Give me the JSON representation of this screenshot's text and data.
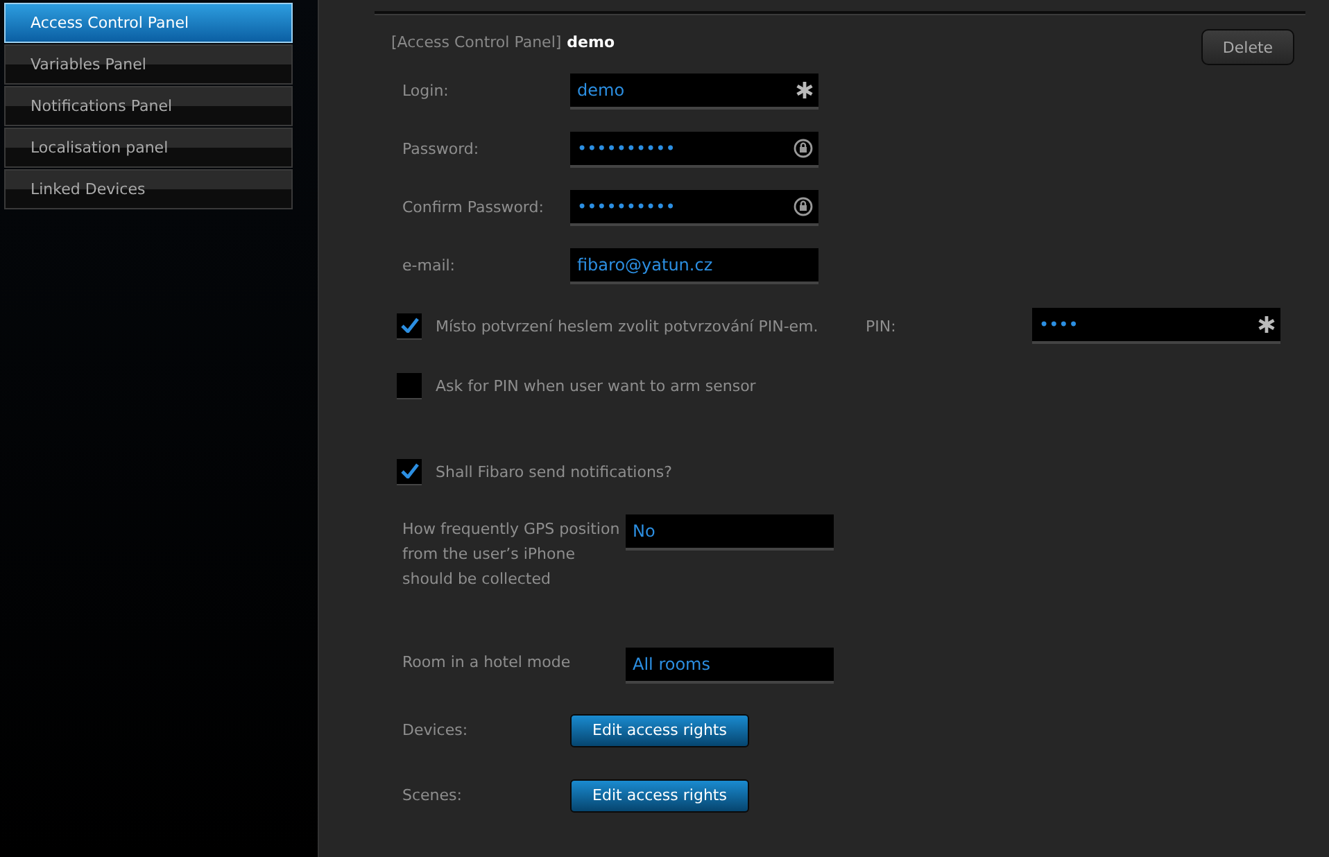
{
  "sidebar": {
    "items": [
      {
        "label": "Access Control Panel",
        "selected": true
      },
      {
        "label": "Variables Panel",
        "selected": false
      },
      {
        "label": "Notifications Panel",
        "selected": false
      },
      {
        "label": "Localisation panel",
        "selected": false
      },
      {
        "label": "Linked Devices",
        "selected": false
      }
    ]
  },
  "header": {
    "section": "[Access Control Panel]",
    "name": "demo",
    "delete_button": "Delete"
  },
  "fields": [
    {
      "label": "Login:",
      "value": "demo",
      "kind": "required"
    },
    {
      "label": "Password:",
      "value": "••••••••••",
      "kind": "password"
    },
    {
      "label": "Confirm Password:",
      "value": "••••••••••",
      "kind": "password"
    },
    {
      "label": "e-mail:",
      "value": "fibaro@yatun.cz",
      "kind": "plain"
    }
  ],
  "pin_option": {
    "label": "Místo potvrzení heslem zvolit potvrzování PIN-em.",
    "checked": true,
    "pin_label": "PIN:",
    "pin_value": "••••"
  },
  "arm_option": {
    "label": "Ask for PIN when user want to arm sensor",
    "checked": false
  },
  "notify_option": {
    "label": "Shall Fibaro send notifications?",
    "checked": true
  },
  "selects": [
    {
      "label": "How frequently GPS position from the user’s iPhone should be collected",
      "value": "No"
    },
    {
      "label": "Room in a hotel mode",
      "value": "All rooms"
    }
  ],
  "access": [
    {
      "label": "Devices:",
      "button": "Edit access rights"
    },
    {
      "label": "Scenes:",
      "button": "Edit access rights"
    }
  ]
}
